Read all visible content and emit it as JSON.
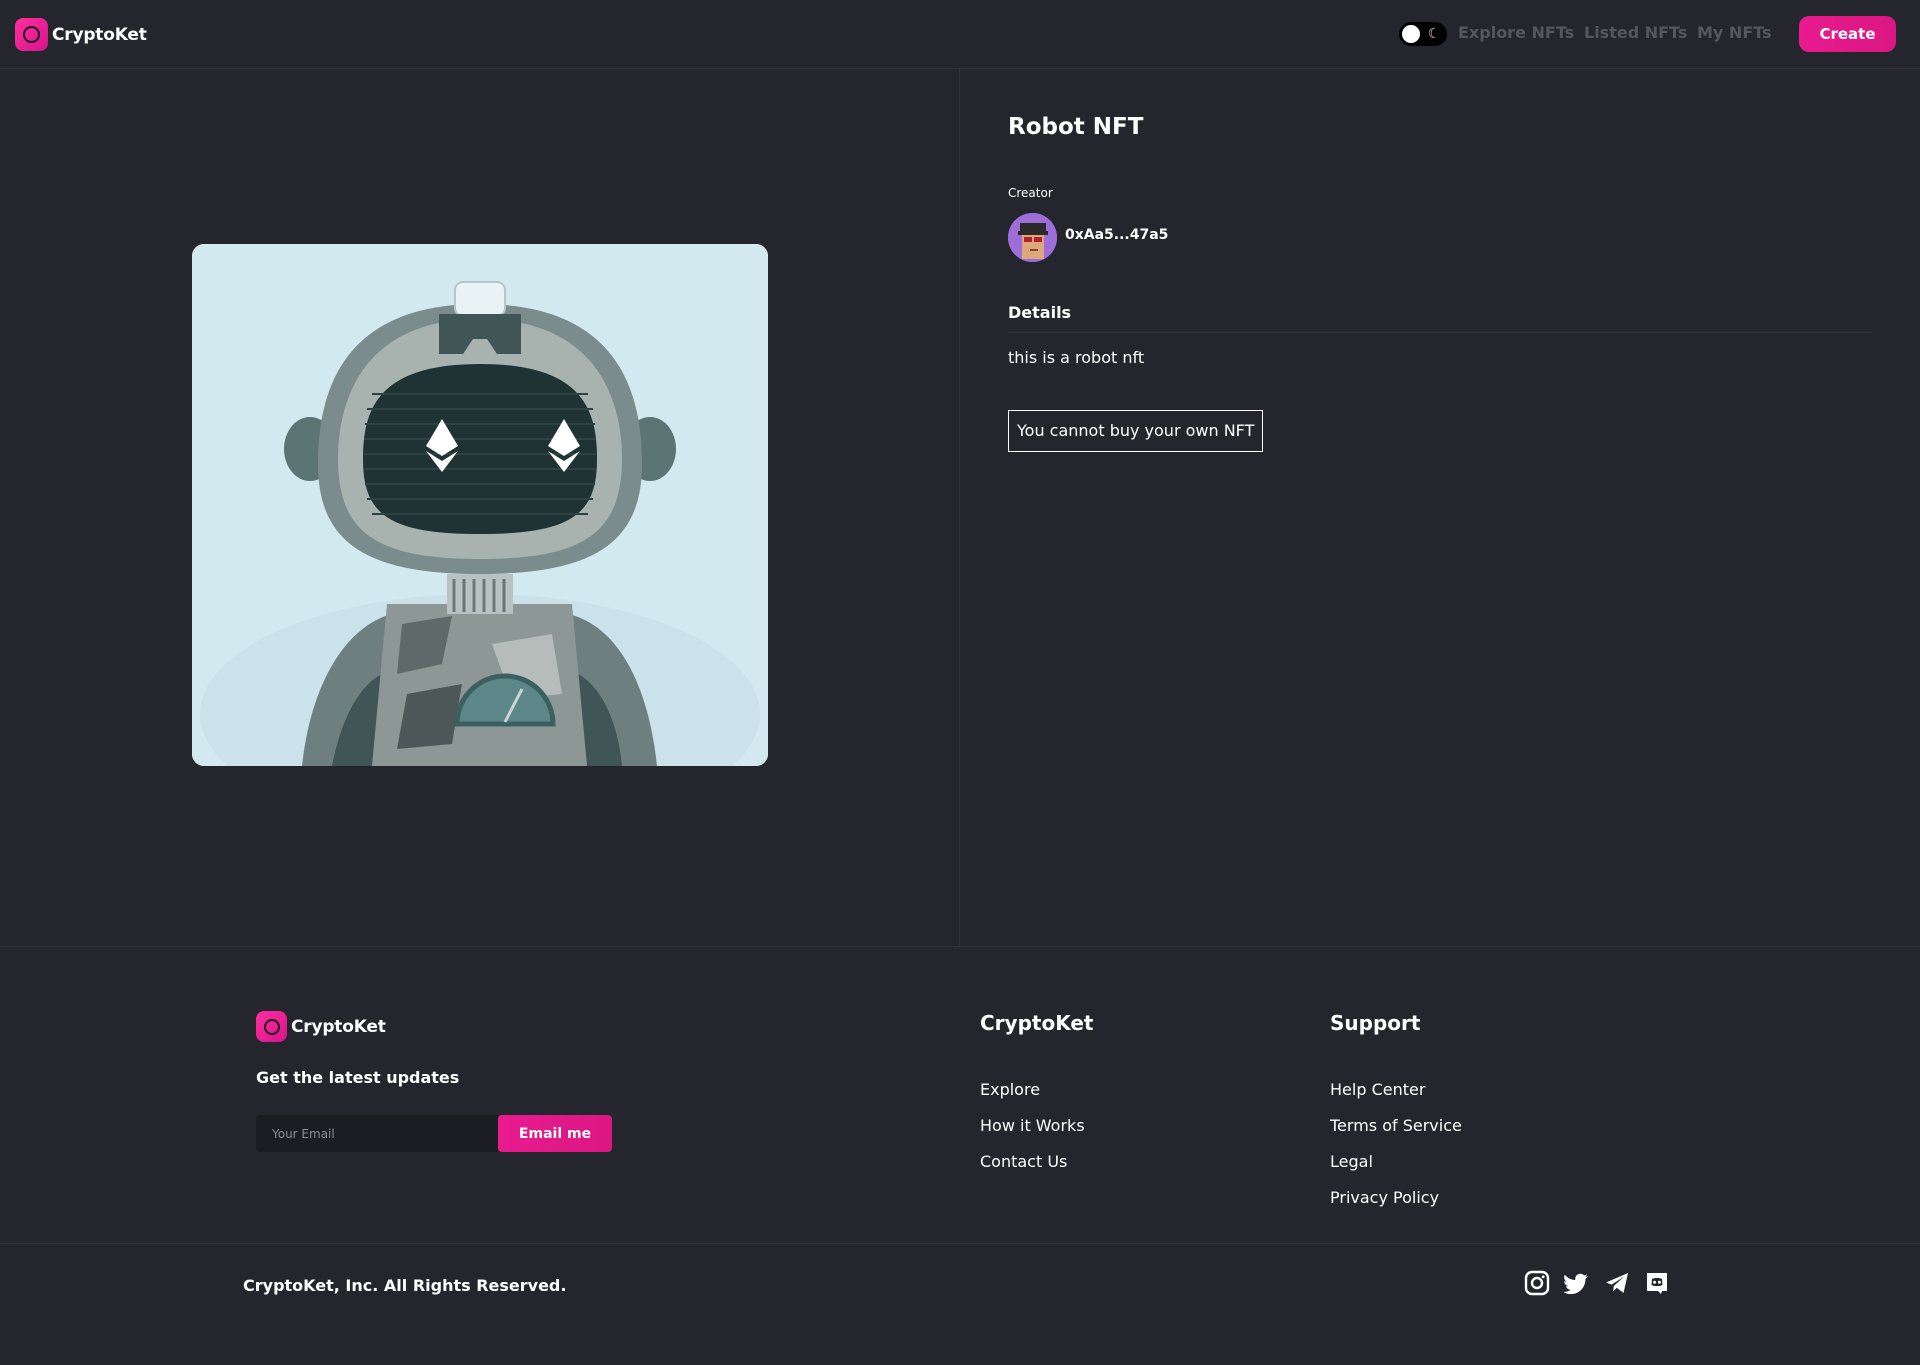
{
  "navbar": {
    "brand": "CryptoKet",
    "links": [
      "Explore NFTs",
      "Listed NFTs",
      "My NFTs"
    ],
    "create_label": "Create"
  },
  "nft": {
    "title": "Robot NFT",
    "creator_label": "Creator",
    "creator_address": "0xAa5...47a5",
    "details_title": "Details",
    "description": "this is a robot nft",
    "status_message": "You cannot buy your own NFT"
  },
  "footer": {
    "brand": "CryptoKet",
    "updates_title": "Get the latest updates",
    "email_placeholder": "Your Email",
    "email_button": "Email me",
    "columns": [
      {
        "title": "CryptoKet",
        "links": [
          "Explore",
          "How it Works",
          "Contact Us"
        ]
      },
      {
        "title": "Support",
        "links": [
          "Help Center",
          "Terms of Service",
          "Legal",
          "Privacy Policy"
        ]
      }
    ],
    "copyright": "CryptoKet, Inc. All Rights Reserved.",
    "socials": [
      "instagram-icon",
      "twitter-icon",
      "telegram-icon",
      "discord-icon"
    ]
  },
  "colors": {
    "background": "#24252d",
    "accent": "#e81b8f",
    "muted_nav": "#55565f",
    "image_backdrop": "#d4e8ef"
  }
}
